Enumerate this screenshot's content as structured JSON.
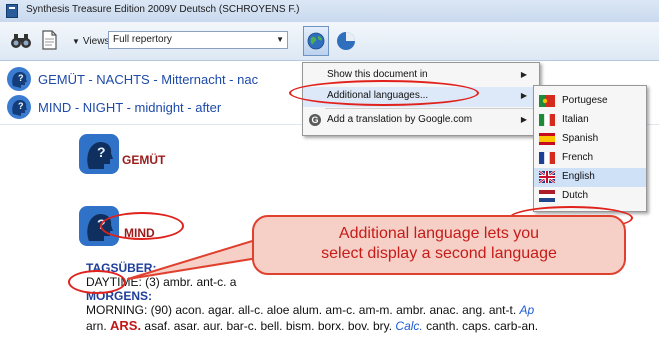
{
  "window": {
    "title": "Synthesis Treasure Edition 2009V Deutsch (SCHROYENS F.)"
  },
  "toolbar": {
    "views_label": "Views:",
    "views_value": "Full repertory"
  },
  "tabs": [
    {
      "label": "GEMÜT - NACHTS - Mitternacht - nac"
    },
    {
      "label": "MIND - NIGHT - midnight - after"
    }
  ],
  "context_menu": {
    "items": [
      {
        "label": "Show this document in",
        "has_submenu": true
      },
      {
        "label": "Additional languages...",
        "has_submenu": true
      },
      {
        "label": "Add a translation by Google.com",
        "has_submenu": true
      }
    ]
  },
  "languages_submenu": {
    "items": [
      {
        "label": "Portugese",
        "flag": "portugal-flag"
      },
      {
        "label": "Italian",
        "flag": "italy-flag"
      },
      {
        "label": "Spanish",
        "flag": "spain-flag"
      },
      {
        "label": "French",
        "flag": "france-flag"
      },
      {
        "label": "English",
        "flag": "uk-flag",
        "selected": true
      },
      {
        "label": "Dutch",
        "flag": "netherlands-flag"
      }
    ]
  },
  "content": {
    "chapter_de": "GEMÜT",
    "chapter_en": "MIND",
    "rubric_de": "TAGSÜBER:",
    "rubric_en_label": "DAYTIME:",
    "rubric_en_rest": " (3) ambr. ant-c. a",
    "rubric2_de": "MORGENS:",
    "morning_label": "MORNING:",
    "morning_text": " (90) acon. agar. all-c. aloe alum. am-c. am-m. ambr. anac. ang. ant-t.",
    "morning_tail": "Ap",
    "line2_pre": "arn. ",
    "line2_ars": "ARS.",
    "line2_mid": " asaf. asar. aur. bar-c. bell. bism. borx. bov. bry. ",
    "line2_calc": "Calc.",
    "line2_post": " canth. caps. carb-an."
  },
  "annotation": {
    "callout_line1": "Additional language lets you",
    "callout_line2": "select display a second language",
    "accent_color": "#e0211c",
    "callout_fill": "#f6cfc7"
  }
}
